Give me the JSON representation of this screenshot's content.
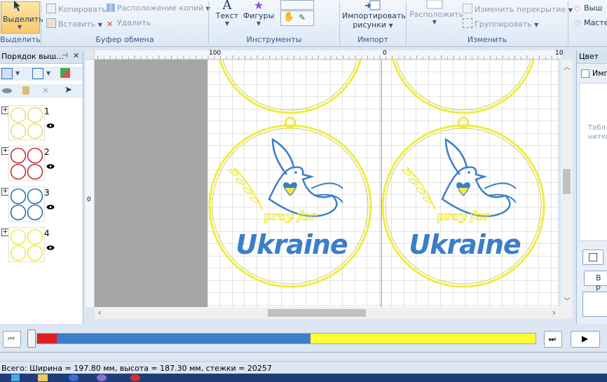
{
  "ribbon": {
    "select_label": "Выделить",
    "groups": {
      "select": "Выделить",
      "clipboard": "Буфер обмена",
      "tools": "Инструменты",
      "import": "Импорт",
      "edit": "Изменить"
    },
    "clipboard": {
      "copy": "Копировать",
      "paste": "Вставить",
      "copy_layout": "Расположение копий",
      "delete": "Удалить"
    },
    "tools": {
      "text": "Текст",
      "shapes": "Фигуры"
    },
    "import_label_1": "Импортировать",
    "import_label_2": "рисунки",
    "edit": {
      "arrange": "Расположить",
      "change_overlap": "Изменить перекрытие",
      "group": "Группировать"
    },
    "right_1": "Выш",
    "right_2": "Масте"
  },
  "left_panel": {
    "title": "Порядок выш...",
    "items": [
      {
        "number": "1",
        "color": "#e8e070"
      },
      {
        "number": "2",
        "color": "#c0303a"
      },
      {
        "number": "3",
        "color": "#2d6fb0"
      },
      {
        "number": "4",
        "color": "#f0ec40"
      }
    ]
  },
  "ruler": {
    "top_left": "100",
    "top_mid": "0",
    "top_right": "10",
    "left_mark": "0"
  },
  "design": {
    "word": "Ukraine",
    "phrase": "pray for",
    "yellow": "#f0ec40",
    "blue": "#3b7ec8"
  },
  "right_panel": {
    "title": "Цвет",
    "item": "Имп",
    "text1": "Табл",
    "text2": "нитей",
    "button": "В р"
  },
  "timeline": {
    "segments": [
      {
        "color": "#e02020",
        "fraction": 0.04
      },
      {
        "color": "#3b7ec8",
        "fraction": 0.508
      },
      {
        "color": "#ffff33",
        "fraction": 0.452
      }
    ]
  },
  "status": {
    "text": "Всего: Ширина = 197.80 мм, высота = 187.30 мм, стежки = 20257"
  }
}
